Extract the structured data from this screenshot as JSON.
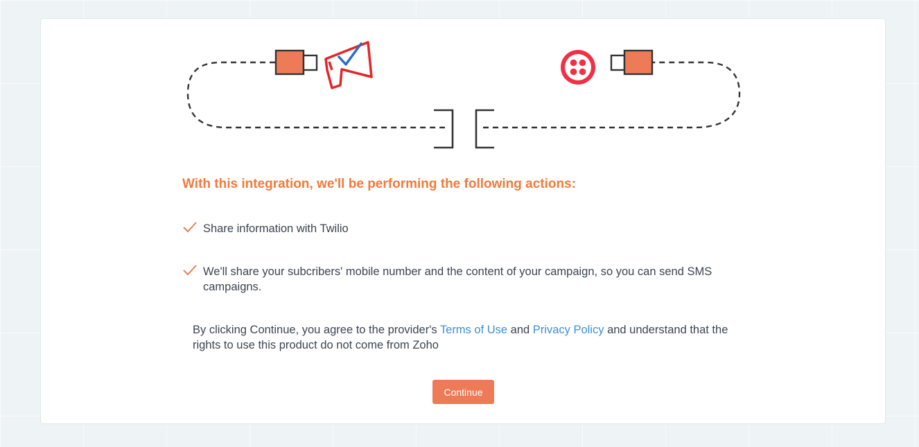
{
  "colors": {
    "accent": "#f07a3d",
    "link": "#3b8fd4",
    "connector": "#ee7b58",
    "zoho_red": "#e42527",
    "zoho_blue": "#2b6cc4",
    "twilio_red": "#f22f46"
  },
  "illustration": {
    "left_logo": "zoho-campaigns-megaphone-icon",
    "right_logo": "twilio-logo-icon"
  },
  "heading": "With this integration, we'll be performing the following actions:",
  "actions": [
    {
      "icon": "check-icon",
      "text": "Share information with Twilio"
    },
    {
      "icon": "check-icon",
      "text": "We'll share your subcribers' mobile number and the content of your campaign, so you can send SMS campaigns."
    }
  ],
  "consent": {
    "prefix": "By clicking Continue, you agree to the provider's ",
    "terms_link": "Terms of Use",
    "middle": " and ",
    "privacy_link": "Privacy Policy",
    "suffix": " and understand that the rights to use this product do not come from Zoho"
  },
  "continue_label": "Continue"
}
